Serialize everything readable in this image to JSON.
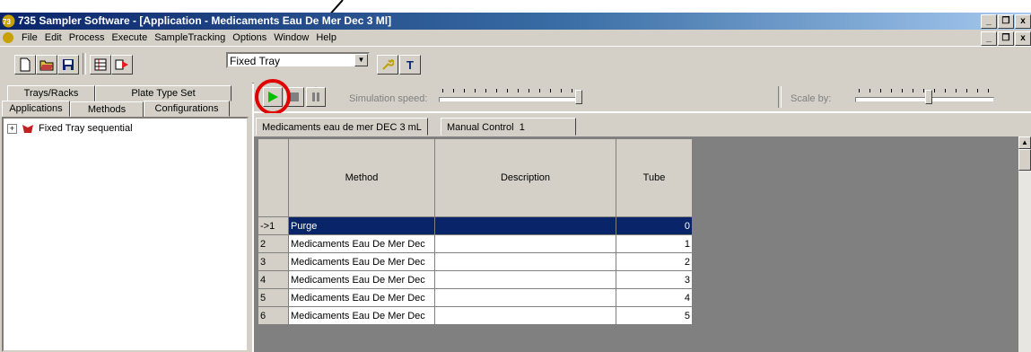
{
  "window": {
    "title": "735 Sampler Software - [Application - Medicaments Eau De Mer Dec 3 Ml]",
    "controls": [
      "_",
      "̸",
      "x"
    ]
  },
  "menu": {
    "items": [
      "File",
      "Edit",
      "Process",
      "Execute",
      "SampleTracking",
      "Options",
      "Window",
      "Help"
    ]
  },
  "toolbar": {
    "tray_select_value": "Fixed Tray"
  },
  "left_pane": {
    "tabs_row1": [
      "Trays/Racks",
      "Plate Type Set"
    ],
    "tabs_row2": [
      "Applications",
      "Methods",
      "Configurations"
    ],
    "active_tab": "Methods",
    "tree": [
      {
        "label": "Fixed Tray sequential",
        "expander": "+"
      }
    ]
  },
  "simulation": {
    "speed_label": "Simulation speed:",
    "scale_label": "Scale by:"
  },
  "doc_tabs": [
    "Medicaments eau de mer DEC 3 mL",
    "Manual Control",
    "1"
  ],
  "table": {
    "columns": [
      "Method",
      "Description",
      "Tube"
    ],
    "rows": [
      {
        "row": "->1",
        "method": "Purge",
        "description": "",
        "tube": "0",
        "selected": true
      },
      {
        "row": "2",
        "method": "Medicaments Eau De Mer Dec",
        "description": "",
        "tube": "1"
      },
      {
        "row": "3",
        "method": "Medicaments Eau De Mer Dec",
        "description": "",
        "tube": "2"
      },
      {
        "row": "4",
        "method": "Medicaments Eau De Mer Dec",
        "description": "",
        "tube": "3"
      },
      {
        "row": "5",
        "method": "Medicaments Eau De Mer Dec",
        "description": "",
        "tube": "4"
      },
      {
        "row": "6",
        "method": "Medicaments Eau De Mer Dec",
        "description": "",
        "tube": "5"
      }
    ]
  },
  "colors": {
    "titlebar_start": "#0a246a",
    "titlebar_end": "#a6caf0",
    "chrome": "#d4d0c8",
    "selection": "#0a246a",
    "play_green": "#00c000",
    "annotation_red": "#e00000"
  }
}
